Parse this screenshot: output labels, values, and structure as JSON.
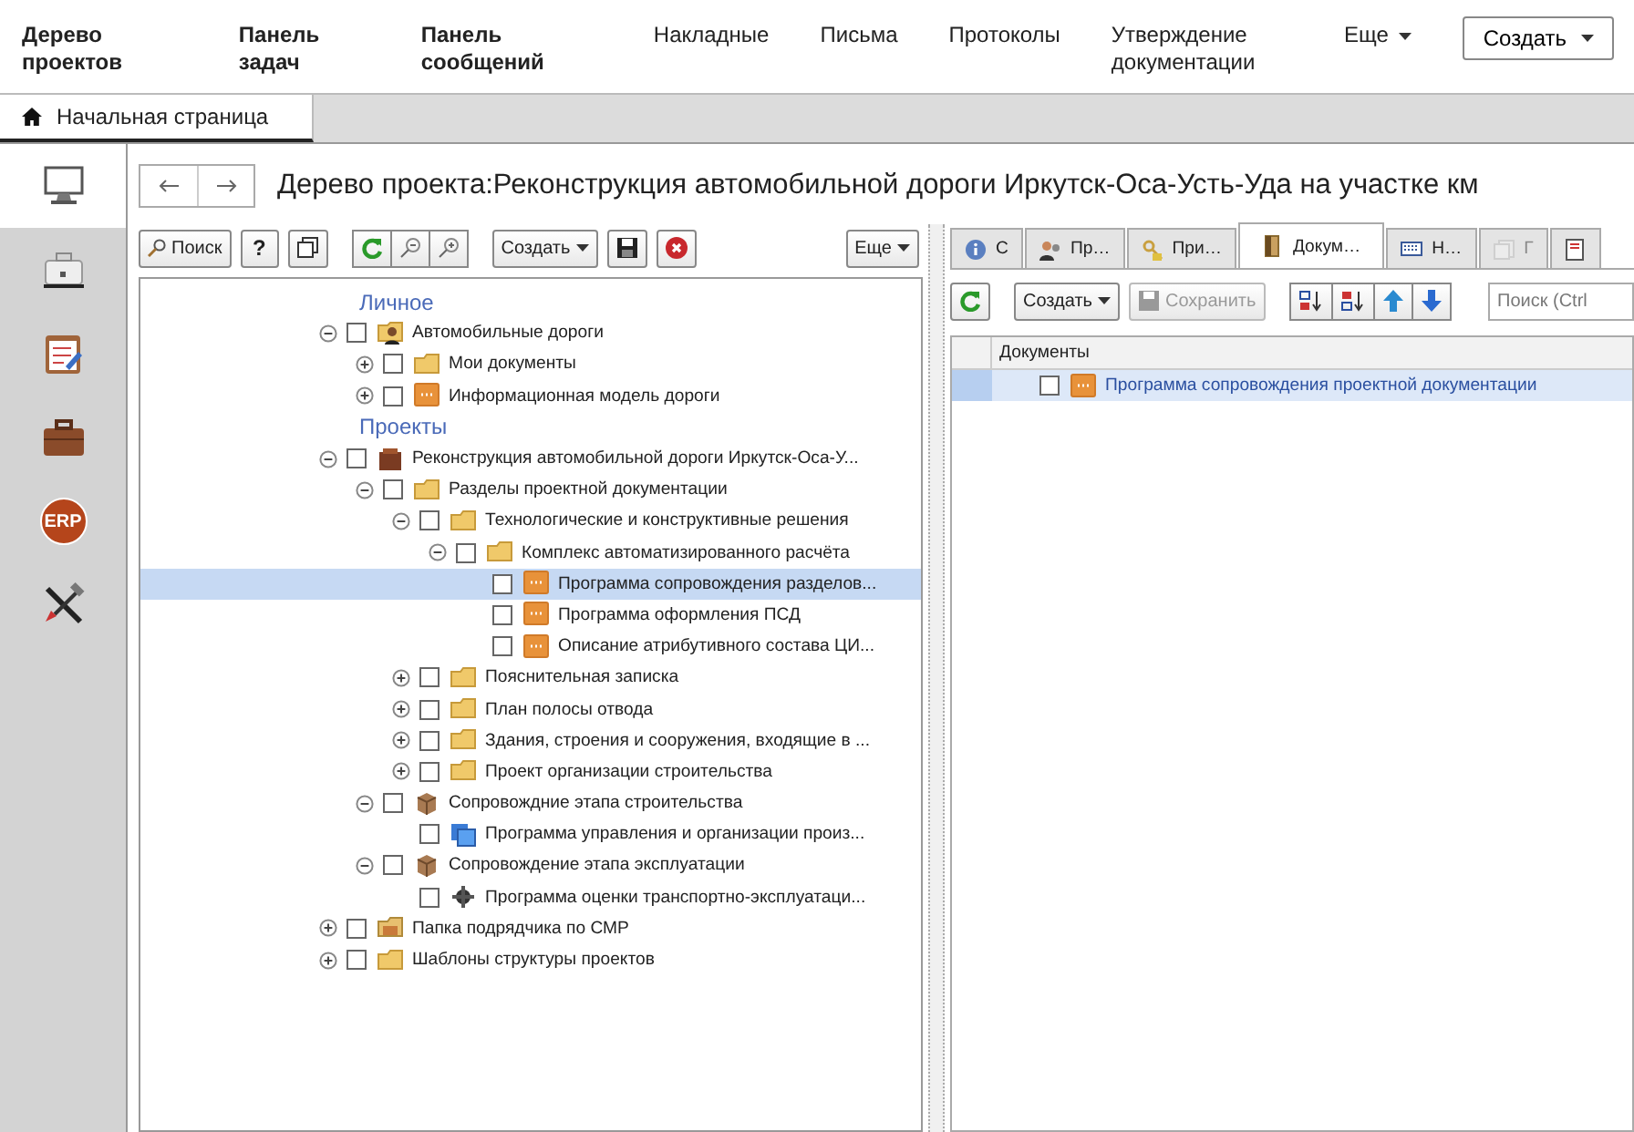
{
  "menu": [
    {
      "label": "Дерево проектов",
      "bold": true
    },
    {
      "label": "Панель задач",
      "bold": true
    },
    {
      "label": "Панель сообщений",
      "bold": true
    },
    {
      "label": "Накладные",
      "bold": false
    },
    {
      "label": "Письма",
      "bold": false
    },
    {
      "label": "Протоколы",
      "bold": false
    },
    {
      "label": "Утверждение документации",
      "bold": false
    },
    {
      "label": "Еще",
      "bold": false,
      "dropdown": true
    }
  ],
  "create_button": {
    "label": "Создать"
  },
  "home_tab": {
    "label": "Начальная страница",
    "selected": true
  },
  "sidebar": {
    "items": [
      {
        "kind": "desktop",
        "selected": true
      },
      {
        "kind": "case",
        "selected": false
      },
      {
        "kind": "checklist",
        "selected": false
      },
      {
        "kind": "briefcase",
        "selected": false
      },
      {
        "kind": "erp",
        "label": "ERP",
        "selected": false
      },
      {
        "kind": "tools",
        "selected": false
      }
    ]
  },
  "window": {
    "title": "Дерево проекта:Реконструкция автомобильной дороги Иркутск-Оса-Усть-Уда на участке км"
  },
  "tree_toolbar": {
    "search": "Поиск",
    "help": "?",
    "create": "Создать",
    "more": "Еще"
  },
  "tree": {
    "items": [
      {
        "kind": "group",
        "label": "Личное",
        "children": [
          {
            "kind": "user-folder",
            "label": "Автомобильные дороги",
            "expanded": true,
            "checked": false,
            "selected": false,
            "children": [
              {
                "kind": "folder",
                "label": "Мои документы",
                "expanded": false,
                "checked": false,
                "selected": false
              },
              {
                "kind": "document",
                "label": "Информационная модель дороги",
                "expanded": false,
                "checked": false,
                "selected": false
              }
            ]
          }
        ]
      },
      {
        "kind": "group",
        "label": "Проекты",
        "children": [
          {
            "kind": "project",
            "label": "Реконструкция автомобильной дороги Иркутск-Оса-У...",
            "expanded": true,
            "checked": false,
            "selected": false,
            "children": [
              {
                "kind": "folder",
                "label": "Разделы проектной документации",
                "expanded": true,
                "checked": false,
                "selected": false,
                "children": [
                  {
                    "kind": "folder",
                    "label": "Технологические и конструктивные решения",
                    "expanded": true,
                    "checked": false,
                    "selected": false,
                    "children": [
                      {
                        "kind": "folder",
                        "label": "Комплекс автоматизированного расчёта",
                        "expanded": true,
                        "checked": false,
                        "selected": false,
                        "children": [
                          {
                            "kind": "document",
                            "label": "Программа сопровождения разделов...",
                            "checked": false,
                            "selected": true
                          },
                          {
                            "kind": "document",
                            "label": "Программа оформления ПСД",
                            "checked": false,
                            "selected": false
                          },
                          {
                            "kind": "document",
                            "label": "Описание атрибутивного состава ЦИ...",
                            "checked": false,
                            "selected": false
                          }
                        ]
                      }
                    ]
                  },
                  {
                    "kind": "folder",
                    "label": "Пояснительная записка",
                    "expanded": false,
                    "checked": false,
                    "selected": false
                  },
                  {
                    "kind": "folder",
                    "label": "План полосы отвода",
                    "expanded": false,
                    "checked": false,
                    "selected": false
                  },
                  {
                    "kind": "folder",
                    "label": "Здания, строения и сооружения, входящие в ...",
                    "expanded": false,
                    "checked": false,
                    "selected": false
                  },
                  {
                    "kind": "folder",
                    "label": "Проект организации строительства",
                    "expanded": false,
                    "checked": false,
                    "selected": false
                  }
                ]
              },
              {
                "kind": "stage",
                "label": "Сопровождние этапа строительства",
                "expanded": true,
                "checked": false,
                "selected": false,
                "children": [
                  {
                    "kind": "app",
                    "label": "Программа управления и организации произ...",
                    "checked": false,
                    "selected": false
                  }
                ]
              },
              {
                "kind": "stage",
                "label": "Сопровождение этапа эксплуатации",
                "expanded": true,
                "checked": false,
                "selected": false,
                "children": [
                  {
                    "kind": "program",
                    "label": "Программа оценки транспортно-эксплуатаци...",
                    "checked": false,
                    "selected": false
                  }
                ]
              }
            ]
          },
          {
            "kind": "contractor-folder",
            "label": "Папка подрядчика по СМР",
            "expanded": false,
            "checked": false,
            "selected": false
          },
          {
            "kind": "folder",
            "label": "Шаблоны структуры проектов",
            "expanded": false,
            "checked": false,
            "selected": false
          }
        ]
      }
    ]
  },
  "detail_tabs": [
    {
      "kind": "info",
      "label": "С",
      "selected": false,
      "disabled": false
    },
    {
      "kind": "people",
      "label": "Пр…",
      "selected": false,
      "disabled": false
    },
    {
      "kind": "key",
      "label": "При…",
      "selected": false,
      "disabled": false
    },
    {
      "kind": "door",
      "label": "Докум…",
      "selected": true,
      "disabled": false
    },
    {
      "kind": "keyboard",
      "label": "Н…",
      "selected": false,
      "disabled": false
    },
    {
      "kind": "pages",
      "label": "Г",
      "selected": false,
      "disabled": true
    },
    {
      "kind": "report",
      "selected": false,
      "disabled": false
    }
  ],
  "detail_toolbar": {
    "create": "Создать",
    "save": "Сохранить",
    "save_disabled": true,
    "search_placeholder": "Поиск (Ctrl"
  },
  "table": {
    "columns": [
      "Документы"
    ],
    "rows": [
      {
        "kind": "document",
        "title": "Программа сопровождения проектной документации",
        "checked": false,
        "selected": true
      }
    ]
  }
}
